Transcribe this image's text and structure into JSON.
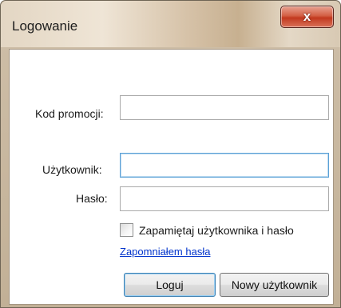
{
  "window": {
    "title": "Logowanie",
    "close_symbol": "x"
  },
  "form": {
    "promo_label": "Kod promocji:",
    "promo_value": "",
    "user_label": "Użytkownik:",
    "user_value": "",
    "password_label": "Hasło:",
    "password_value": "",
    "remember_label": "Zapamiętaj użytkownika i hasło",
    "remember_checked": false,
    "forgot_link": "Zapomniałem hasła"
  },
  "buttons": {
    "login_label": "Loguj",
    "new_user_label": "Nowy użytkownik"
  }
}
